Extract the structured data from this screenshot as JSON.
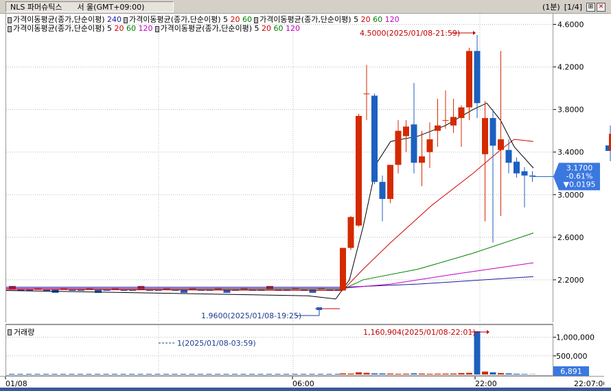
{
  "window": {
    "symbol": "NLS 파머슈틱스",
    "location": "서 울(GMT+09:00)",
    "interval": "(1분)",
    "page": "[1/4]"
  },
  "legend": {
    "line1": [
      {
        "label": "가격이동평균(종가,단순이평)",
        "values": [
          {
            "v": "240",
            "c": "#1a1aa0"
          }
        ]
      },
      {
        "label": "가격이동평균(종가,단순이평)",
        "values": [
          {
            "v": "5",
            "c": "#000"
          },
          {
            "v": "20",
            "c": "#d10000"
          },
          {
            "v": "60",
            "c": "#008000"
          }
        ]
      },
      {
        "label": "가격이동평균(종가,단순이평)",
        "values": [
          {
            "v": "5",
            "c": "#000"
          },
          {
            "v": "20",
            "c": "#d10000"
          },
          {
            "v": "60",
            "c": "#008000"
          },
          {
            "v": "120",
            "c": "#c000c0"
          }
        ]
      }
    ],
    "line2": [
      {
        "label": "가격이동평균(종가,단순이평)",
        "values": [
          {
            "v": "5",
            "c": "#000"
          },
          {
            "v": "20",
            "c": "#d10000"
          },
          {
            "v": "60",
            "c": "#008000"
          },
          {
            "v": "120",
            "c": "#c000c0"
          }
        ]
      },
      {
        "label": "가격이동평균(종가,단순이평)",
        "values": [
          {
            "v": "5",
            "c": "#000"
          },
          {
            "v": "20",
            "c": "#d10000"
          },
          {
            "v": "60",
            "c": "#008000"
          },
          {
            "v": "120",
            "c": "#c000c0"
          }
        ]
      }
    ]
  },
  "colors": {
    "up": "#d42a00",
    "down": "#1c60c0",
    "ma5": "#000000",
    "ma20": "#d10000",
    "ma60": "#008000",
    "ma120": "#c000c0",
    "ma240": "#1a1aa0",
    "badge": "#3a78e0"
  },
  "annotations": {
    "high": "4.5000(2025/01/08-21:59)",
    "low": "1.9600(2025/01/08-19:25)",
    "vol_high": "1,160,904(2025/01/08-22:01)",
    "vol_low": "1(2025/01/08-03:59)"
  },
  "current": {
    "price": "3.1700",
    "change_pct": "-0.61%",
    "change": "▼0.0195"
  },
  "volume": {
    "title": "거래량",
    "current": "6,891"
  },
  "time_axis": {
    "start": "01/08",
    "t1": "06:00",
    "t2": "22:00",
    "end": "22:07:00"
  },
  "chart_data": {
    "type": "candlestick",
    "price_axis": {
      "min": 1.8,
      "max": 4.7,
      "ticks": [
        "4.6000",
        "4.2000",
        "3.8000",
        "3.4000",
        "3.0000",
        "2.6000",
        "2.2000"
      ]
    },
    "volume_axis": {
      "max": 1250000,
      "ticks": [
        "1,000,000",
        "500,000"
      ]
    },
    "candles": [
      {
        "o": 2.1,
        "h": 2.5,
        "l": 2.1,
        "c": 2.5
      },
      {
        "o": 2.5,
        "h": 2.8,
        "l": 2.48,
        "c": 2.79
      },
      {
        "o": 2.71,
        "h": 3.76,
        "l": 2.7,
        "c": 3.74
      },
      {
        "o": 3.95,
        "h": 4.22,
        "l": 3.7,
        "c": 3.95
      },
      {
        "o": 3.93,
        "h": 3.95,
        "l": 3.1,
        "c": 3.12
      },
      {
        "o": 3.12,
        "h": 3.18,
        "l": 2.75,
        "c": 2.96
      },
      {
        "o": 2.96,
        "h": 3.28,
        "l": 2.92,
        "c": 3.28
      },
      {
        "o": 3.28,
        "h": 3.7,
        "l": 3.2,
        "c": 3.6
      },
      {
        "o": 3.55,
        "h": 3.7,
        "l": 3.4,
        "c": 3.64
      },
      {
        "o": 3.66,
        "h": 4.05,
        "l": 3.2,
        "c": 3.3
      },
      {
        "o": 3.3,
        "h": 3.6,
        "l": 3.08,
        "c": 3.36
      },
      {
        "o": 3.4,
        "h": 3.68,
        "l": 3.25,
        "c": 3.52
      },
      {
        "o": 3.6,
        "h": 3.9,
        "l": 3.45,
        "c": 3.65
      },
      {
        "o": 3.7,
        "h": 3.98,
        "l": 3.62,
        "c": 3.7
      },
      {
        "o": 3.65,
        "h": 3.9,
        "l": 3.58,
        "c": 3.73
      },
      {
        "o": 3.72,
        "h": 3.84,
        "l": 3.45,
        "c": 3.82
      },
      {
        "o": 3.82,
        "h": 4.38,
        "l": 3.7,
        "c": 4.35
      },
      {
        "o": 4.35,
        "h": 4.5,
        "l": 3.72,
        "c": 3.86
      },
      {
        "o": 3.38,
        "h": 3.88,
        "l": 2.75,
        "c": 3.72
      },
      {
        "o": 3.72,
        "h": 3.8,
        "l": 2.55,
        "c": 3.46
      },
      {
        "o": 3.42,
        "h": 4.35,
        "l": 2.8,
        "c": 3.52
      },
      {
        "o": 3.42,
        "h": 3.52,
        "l": 3.2,
        "c": 3.3
      },
      {
        "o": 3.31,
        "h": 3.35,
        "l": 3.16,
        "c": 3.2
      },
      {
        "o": 3.22,
        "h": 3.26,
        "l": 2.88,
        "c": 3.18
      },
      {
        "o": 3.18,
        "h": 3.22,
        "l": 3.12,
        "c": 3.17
      }
    ],
    "volumes": [
      30000,
      25000,
      60000,
      45000,
      30000,
      28000,
      25000,
      20000,
      22000,
      30000,
      25000,
      20000,
      22000,
      24000,
      26000,
      40000,
      45000,
      1160904,
      80000,
      60000,
      40000,
      30000,
      20000,
      15000,
      6891
    ]
  }
}
